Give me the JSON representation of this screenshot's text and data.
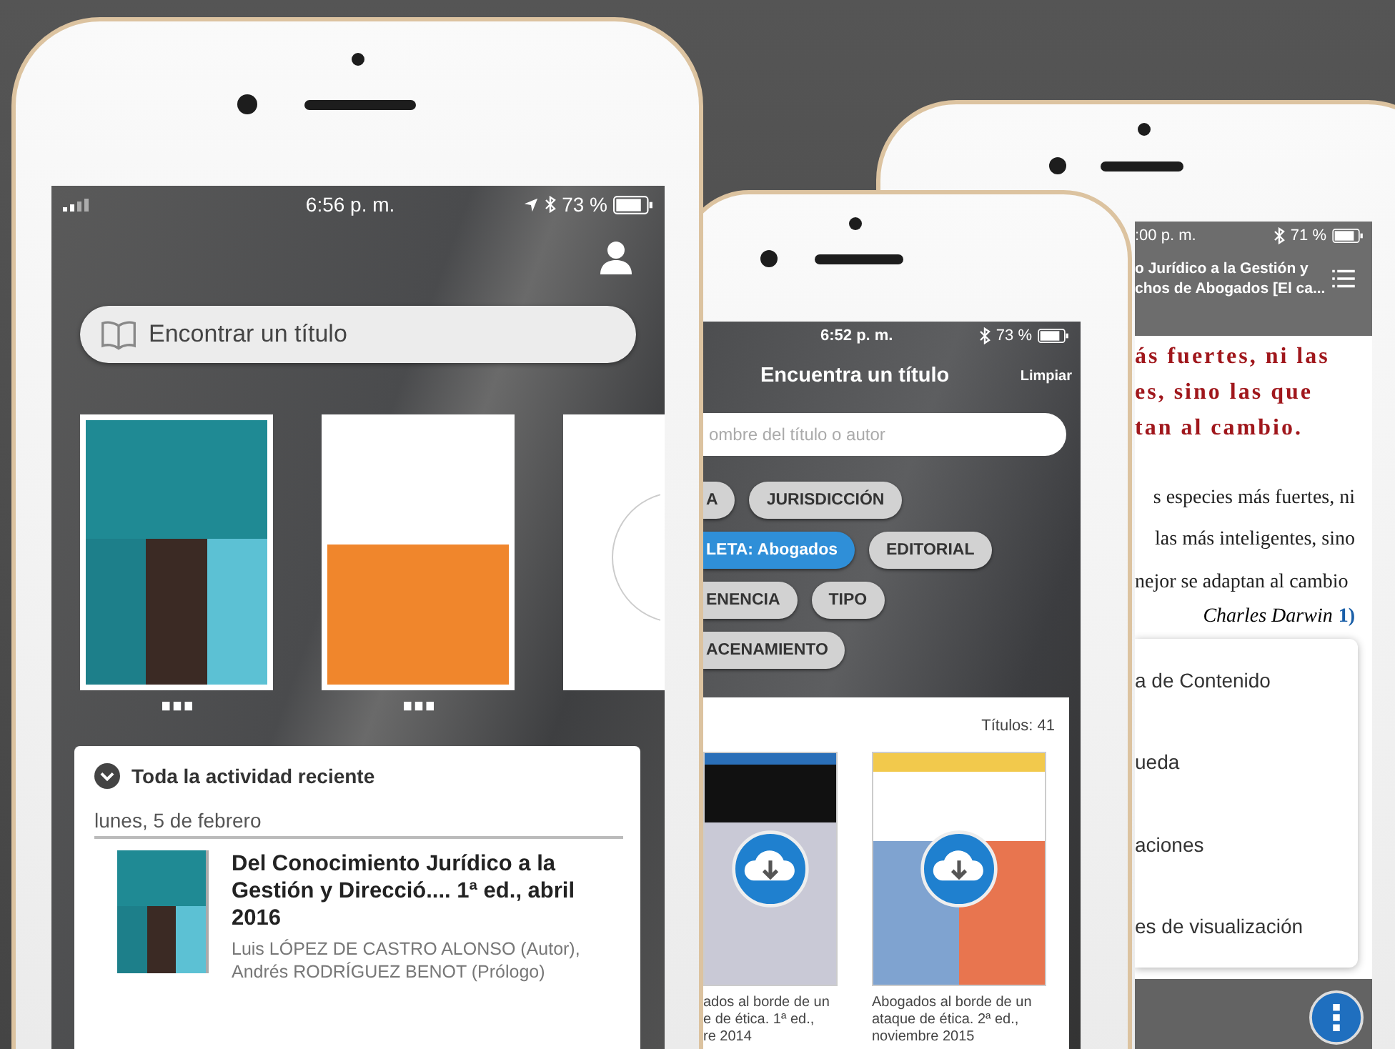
{
  "home_phone": {
    "status": {
      "time": "6:56 p. m.",
      "battery": "73 %"
    },
    "search": {
      "placeholder": "Encontrar un título"
    },
    "books": [
      {
        "kind": "teal"
      },
      {
        "kind": "orange"
      },
      {
        "kind": "white"
      }
    ],
    "activity": {
      "heading": "Toda la actividad reciente",
      "date": "lunes, 5 de febrero",
      "items": [
        {
          "title": "Del Conocimiento Jurídico a la Gestión y Direcció.... 1ª ed., abril 2016",
          "authors": "Luis LÓPEZ DE CASTRO ALONSO (Autor), Andrés RODRÍGUEZ BENOT (Prólogo)"
        }
      ]
    }
  },
  "search_phone": {
    "status": {
      "time": "6:52 p. m.",
      "battery": "73 %"
    },
    "title": "Encuentra un título",
    "action": "Limpiar",
    "search": {
      "placeholder": "ombre del título o autor"
    },
    "filter_rows": [
      [
        {
          "label": "A",
          "selected": false
        },
        {
          "label": "JURISDICCIÓN",
          "selected": false
        }
      ],
      [
        {
          "label": "LETA: Abogados",
          "selected": true
        },
        {
          "label": "EDITORIAL",
          "selected": false
        }
      ],
      [
        {
          "label": "ENENCIA",
          "selected": false
        },
        {
          "label": "TIPO",
          "selected": false
        }
      ],
      [
        {
          "label": "ACENAMIENTO",
          "selected": false
        }
      ]
    ],
    "count": "Títulos: 41",
    "results": [
      {
        "kind": "cut",
        "caption": [
          "ados al borde de un",
          "e de ética. 1ª ed.,",
          "re 2014"
        ]
      },
      {
        "kind": "full",
        "caption": [
          "Abogados al borde de un",
          "ataque de ética. 2ª ed.,",
          "noviembre 2015"
        ]
      }
    ]
  },
  "reader_phone": {
    "status": {
      "time": ":00 p. m.",
      "battery": "71 %"
    },
    "title": [
      "o Jurídico a la Gestión y",
      "chos de Abogados [El ca..."
    ],
    "quote": [
      "ás fuertes, ni las",
      "es, sino las que",
      "tan al cambio."
    ],
    "body": [
      "s especies más fuertes, ni",
      "las más inteligentes, sino",
      "nejor se adaptan al cambio"
    ],
    "attribution": "Charles Darwin",
    "footnote": "1)",
    "menu": [
      "a de Contenido",
      "ueda",
      "aciones",
      "es de visualización"
    ]
  }
}
